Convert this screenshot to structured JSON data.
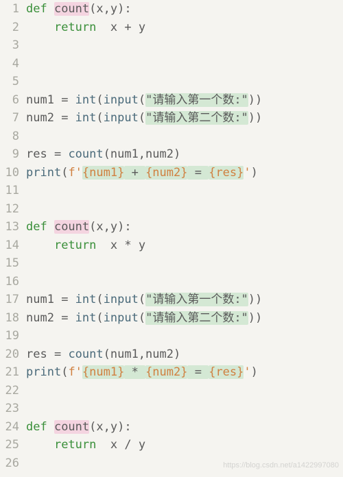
{
  "lines": [
    {
      "n": "1",
      "seg": [
        {
          "t": "def ",
          "c": "kw"
        },
        {
          "t": "count",
          "c": "fn"
        },
        {
          "t": "(x,y):",
          "c": "id"
        }
      ]
    },
    {
      "n": "2",
      "seg": [
        {
          "t": "    ",
          "c": ""
        },
        {
          "t": "return",
          "c": "kw"
        },
        {
          "t": "  x ",
          "c": "id"
        },
        {
          "t": "+",
          "c": "op"
        },
        {
          "t": " y",
          "c": "id"
        }
      ]
    },
    {
      "n": "3",
      "seg": []
    },
    {
      "n": "4",
      "seg": []
    },
    {
      "n": "5",
      "seg": []
    },
    {
      "n": "6",
      "seg": [
        {
          "t": "num1 ",
          "c": "id"
        },
        {
          "t": "=",
          "c": "op"
        },
        {
          "t": " int",
          "c": "call"
        },
        {
          "t": "(",
          "c": "id"
        },
        {
          "t": "input",
          "c": "call"
        },
        {
          "t": "(",
          "c": "id"
        },
        {
          "t": "\"请输入第一个数:\"",
          "c": "str"
        },
        {
          "t": "))",
          "c": "id"
        }
      ]
    },
    {
      "n": "7",
      "seg": [
        {
          "t": "num2 ",
          "c": "id"
        },
        {
          "t": "=",
          "c": "op"
        },
        {
          "t": " int",
          "c": "call"
        },
        {
          "t": "(",
          "c": "id"
        },
        {
          "t": "input",
          "c": "call"
        },
        {
          "t": "(",
          "c": "id"
        },
        {
          "t": "\"请输入第二个数:\"",
          "c": "str"
        },
        {
          "t": "))",
          "c": "id"
        }
      ]
    },
    {
      "n": "8",
      "seg": []
    },
    {
      "n": "9",
      "seg": [
        {
          "t": "res ",
          "c": "id"
        },
        {
          "t": "=",
          "c": "op"
        },
        {
          "t": " count",
          "c": "call"
        },
        {
          "t": "(num1,num2)",
          "c": "id"
        }
      ]
    },
    {
      "n": "10",
      "seg": [
        {
          "t": "print",
          "c": "call"
        },
        {
          "t": "(",
          "c": "id"
        },
        {
          "t": "f'",
          "c": "fs"
        },
        {
          "t": "{num1}",
          "c": "fsb"
        },
        {
          "t": " + ",
          "c": "str"
        },
        {
          "t": "{num2}",
          "c": "fsb"
        },
        {
          "t": " = ",
          "c": "str"
        },
        {
          "t": "{res}",
          "c": "fsb"
        },
        {
          "t": "'",
          "c": "fs"
        },
        {
          "t": ")",
          "c": "id"
        }
      ]
    },
    {
      "n": "11",
      "seg": []
    },
    {
      "n": "12",
      "seg": []
    },
    {
      "n": "13",
      "seg": [
        {
          "t": "def ",
          "c": "kw"
        },
        {
          "t": "count",
          "c": "fn"
        },
        {
          "t": "(x,y):",
          "c": "id"
        }
      ]
    },
    {
      "n": "14",
      "seg": [
        {
          "t": "    ",
          "c": ""
        },
        {
          "t": "return",
          "c": "kw"
        },
        {
          "t": "  x ",
          "c": "id"
        },
        {
          "t": "*",
          "c": "op"
        },
        {
          "t": " y",
          "c": "id"
        }
      ]
    },
    {
      "n": "15",
      "seg": []
    },
    {
      "n": "16",
      "seg": []
    },
    {
      "n": "17",
      "seg": [
        {
          "t": "num1 ",
          "c": "id"
        },
        {
          "t": "=",
          "c": "op"
        },
        {
          "t": " int",
          "c": "call"
        },
        {
          "t": "(",
          "c": "id"
        },
        {
          "t": "input",
          "c": "call"
        },
        {
          "t": "(",
          "c": "id"
        },
        {
          "t": "\"请输入第一个数:\"",
          "c": "str"
        },
        {
          "t": "))",
          "c": "id"
        }
      ]
    },
    {
      "n": "18",
      "seg": [
        {
          "t": "num2 ",
          "c": "id"
        },
        {
          "t": "=",
          "c": "op"
        },
        {
          "t": " int",
          "c": "call"
        },
        {
          "t": "(",
          "c": "id"
        },
        {
          "t": "input",
          "c": "call"
        },
        {
          "t": "(",
          "c": "id"
        },
        {
          "t": "\"请输入第二个数:\"",
          "c": "str"
        },
        {
          "t": "))",
          "c": "id"
        }
      ]
    },
    {
      "n": "19",
      "seg": []
    },
    {
      "n": "20",
      "seg": [
        {
          "t": "res ",
          "c": "id"
        },
        {
          "t": "=",
          "c": "op"
        },
        {
          "t": " count",
          "c": "call"
        },
        {
          "t": "(num1,num2)",
          "c": "id"
        }
      ]
    },
    {
      "n": "21",
      "seg": [
        {
          "t": "print",
          "c": "call"
        },
        {
          "t": "(",
          "c": "id"
        },
        {
          "t": "f'",
          "c": "fs"
        },
        {
          "t": "{num1}",
          "c": "fsb"
        },
        {
          "t": " * ",
          "c": "str"
        },
        {
          "t": "{num2}",
          "c": "fsb"
        },
        {
          "t": " = ",
          "c": "str"
        },
        {
          "t": "{res}",
          "c": "fsb"
        },
        {
          "t": "'",
          "c": "fs"
        },
        {
          "t": ")",
          "c": "id"
        }
      ]
    },
    {
      "n": "22",
      "seg": []
    },
    {
      "n": "23",
      "seg": []
    },
    {
      "n": "24",
      "seg": [
        {
          "t": "def ",
          "c": "kw"
        },
        {
          "t": "count",
          "c": "fn"
        },
        {
          "t": "(x,y):",
          "c": "id"
        }
      ]
    },
    {
      "n": "25",
      "seg": [
        {
          "t": "    ",
          "c": ""
        },
        {
          "t": "return",
          "c": "kw"
        },
        {
          "t": "  x ",
          "c": "id"
        },
        {
          "t": "/",
          "c": "op"
        },
        {
          "t": " y",
          "c": "id"
        }
      ]
    },
    {
      "n": "26",
      "seg": []
    }
  ],
  "watermark": "https://blog.csdn.net/a1422997080"
}
